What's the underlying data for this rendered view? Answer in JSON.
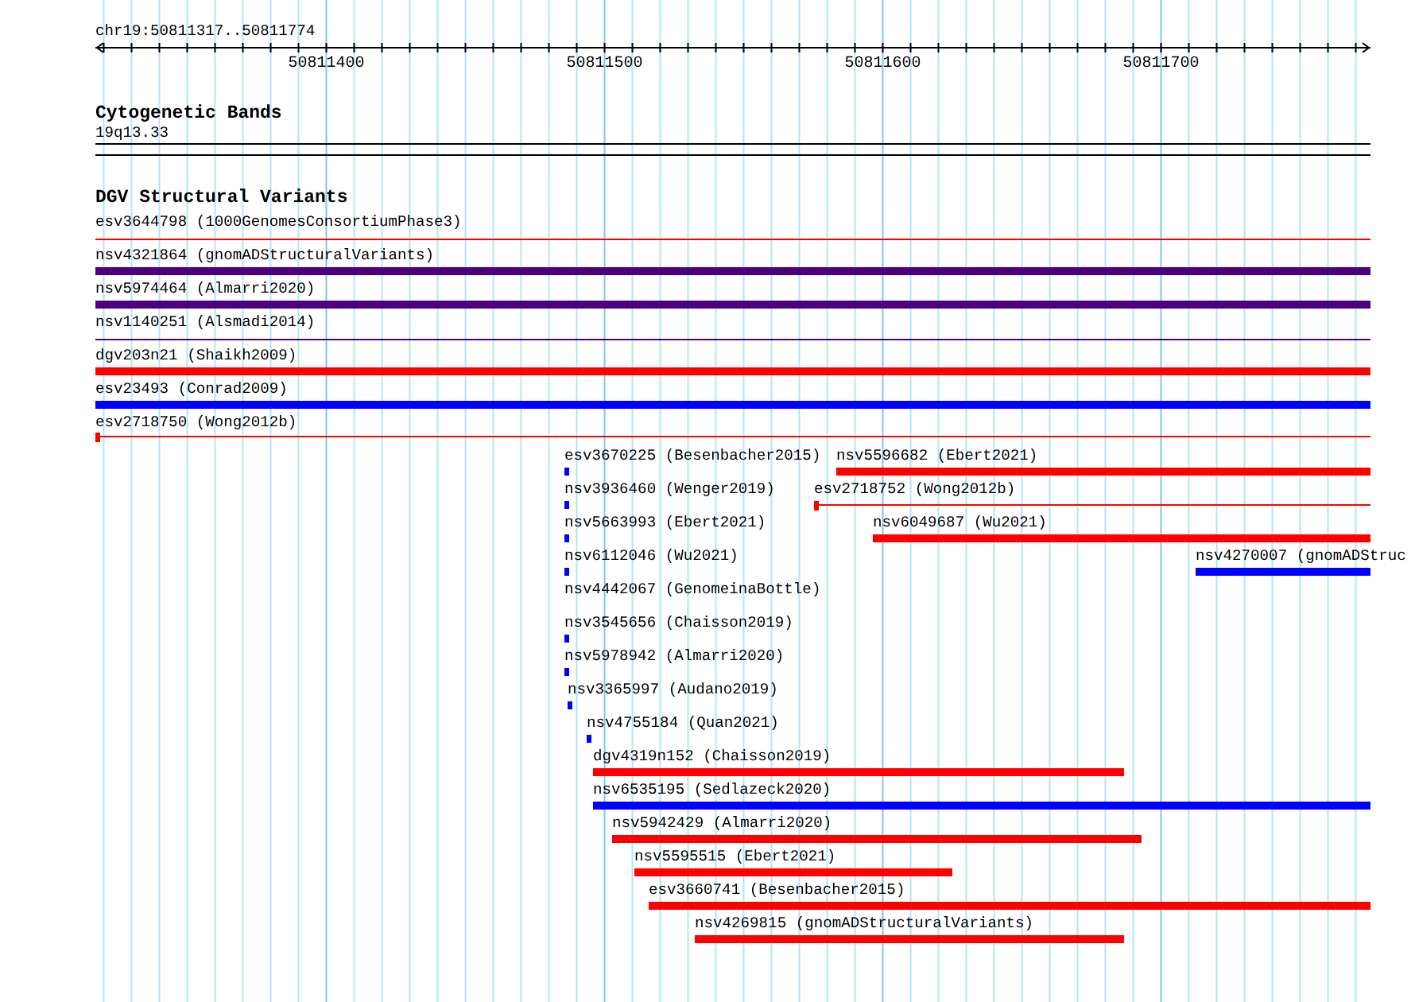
{
  "ruler": {
    "range": "chr19:50811317..50811774",
    "tick_labels": [
      "50811400",
      "50811500",
      "50811600",
      "50811700"
    ]
  },
  "cytogenetic_bands": {
    "title": "Cytogenetic Bands",
    "band": "19q13.33"
  },
  "dgv_track": {
    "title": "DGV Structural Variants",
    "features": [
      {
        "label": "esv3644798 (1000GenomesConsortiumPhase3)",
        "color": "#ff0000",
        "kind": "line"
      },
      {
        "label": "nsv4321864 (gnomADStructuralVariants)",
        "color": "#4b0082",
        "kind": "bar"
      },
      {
        "label": "nsv5974464 (Almarri2020)",
        "color": "#4b0082",
        "kind": "bar"
      },
      {
        "label": "nsv1140251 (Alsmadi2014)",
        "color": "#4b0082",
        "kind": "line"
      },
      {
        "label": "dgv203n21 (Shaikh2009)",
        "color": "#ff0000",
        "kind": "bar"
      },
      {
        "label": "esv23493 (Conrad2009)",
        "color": "#0000ff",
        "kind": "bar"
      },
      {
        "label": "esv2718750 (Wong2012b)",
        "color": "#ff0000",
        "kind": "marked_line"
      },
      {
        "label": "esv3670225 (Besenbacher2015)",
        "color": "#0000ff",
        "kind": "bar"
      },
      {
        "label": "nsv5596682 (Ebert2021)",
        "color": "#ff0000",
        "kind": "bar"
      },
      {
        "label": "nsv3936460 (Wenger2019)",
        "color": "#0000ff",
        "kind": "bar"
      },
      {
        "label": "esv2718752 (Wong2012b)",
        "color": "#ff0000",
        "kind": "marked_line"
      },
      {
        "label": "nsv5663993 (Ebert2021)",
        "color": "#0000ff",
        "kind": "bar"
      },
      {
        "label": "nsv6049687 (Wu2021)",
        "color": "#ff0000",
        "kind": "bar"
      },
      {
        "label": "nsv6112046 (Wu2021)",
        "color": "#0000ff",
        "kind": "bar"
      },
      {
        "label": "nsv4270007 (gnomADStruc",
        "color": "#0000ff",
        "kind": "bar"
      },
      {
        "label": "nsv4442067 (GenomeinaBottle)",
        "kind": "label_only"
      },
      {
        "label": "nsv3545656 (Chaisson2019)",
        "color": "#0000ff",
        "kind": "bar"
      },
      {
        "label": "nsv5978942 (Almarri2020)",
        "color": "#0000ff",
        "kind": "bar"
      },
      {
        "label": "nsv3365997 (Audano2019)",
        "color": "#0000ff",
        "kind": "bar"
      },
      {
        "label": "nsv4755184 (Quan2021)",
        "color": "#0000ff",
        "kind": "bar"
      },
      {
        "label": "dgv4319n152 (Chaisson2019)",
        "color": "#ff0000",
        "kind": "bar"
      },
      {
        "label": "nsv6535195 (Sedlazeck2020)",
        "color": "#0000ff",
        "kind": "bar"
      },
      {
        "label": "nsv5942429 (Almarri2020)",
        "color": "#ff0000",
        "kind": "bar"
      },
      {
        "label": "nsv5595515 (Ebert2021)",
        "color": "#ff0000",
        "kind": "bar"
      },
      {
        "label": "esv3660741 (Besenbacher2015)",
        "color": "#ff0000",
        "kind": "bar"
      },
      {
        "label": "nsv4269815 (gnomADStructuralVariants)",
        "color": "#ff0000",
        "kind": "bar"
      }
    ]
  }
}
